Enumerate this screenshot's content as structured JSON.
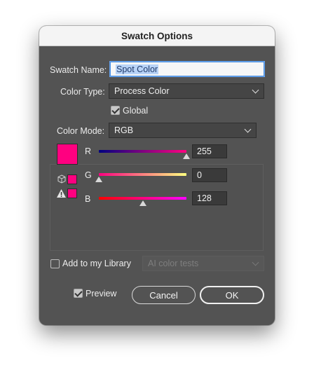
{
  "dialog": {
    "title": "Swatch Options"
  },
  "swatch_name": {
    "label": "Swatch Name:",
    "value": "Spot Color"
  },
  "color_type": {
    "label": "Color Type:",
    "value": "Process Color"
  },
  "global": {
    "label": "Global",
    "checked": true
  },
  "color_mode": {
    "label": "Color Mode:",
    "value": "RGB"
  },
  "current_color": "#ff0080",
  "sliders": [
    {
      "channel": "R",
      "value": "255",
      "fraction": 1.0,
      "gradient": [
        "#000080",
        "#ff0080"
      ]
    },
    {
      "channel": "G",
      "value": "0",
      "fraction": 0.0,
      "gradient": [
        "#ff0080",
        "#ffff80"
      ]
    },
    {
      "channel": "B",
      "value": "128",
      "fraction": 0.5,
      "gradient": [
        "#ff0000",
        "#ff00ff"
      ]
    }
  ],
  "warnings": {
    "web_safe_icon": "cube-icon",
    "out_of_gamut_icon": "warning-triangle-icon"
  },
  "library": {
    "label": "Add to my Library",
    "checked": false,
    "dropdown_value": "AI color tests"
  },
  "preview": {
    "label": "Preview",
    "checked": true
  },
  "buttons": {
    "cancel": "Cancel",
    "ok": "OK"
  }
}
